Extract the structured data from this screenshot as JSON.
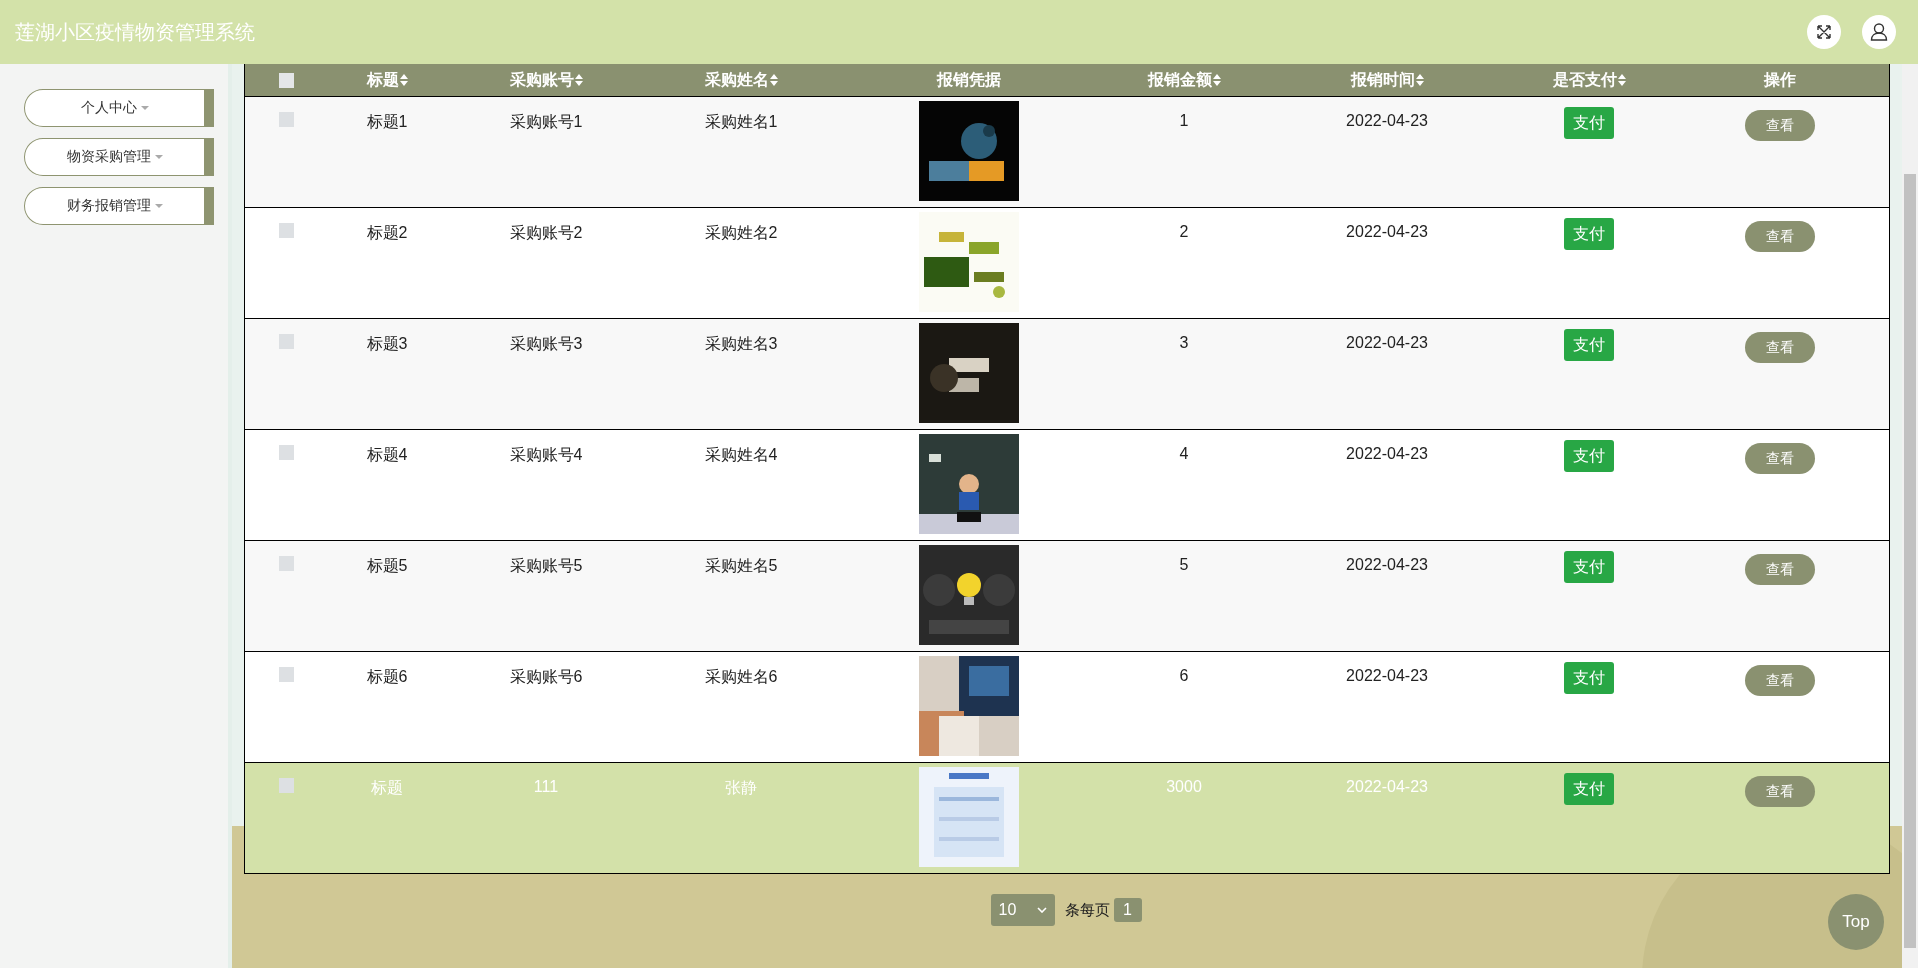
{
  "header": {
    "title": "莲湖小区疫情物资管理系统"
  },
  "sidebar": {
    "items": [
      {
        "label": "个人中心"
      },
      {
        "label": "物资采购管理"
      },
      {
        "label": "财务报销管理"
      }
    ]
  },
  "table": {
    "select_all": {
      "checked": false
    },
    "columns": [
      {
        "label": "标题",
        "sortable": true
      },
      {
        "label": "采购账号",
        "sortable": true
      },
      {
        "label": "采购姓名",
        "sortable": true
      },
      {
        "label": "报销凭据",
        "sortable": false
      },
      {
        "label": "报销金额",
        "sortable": true
      },
      {
        "label": "报销时间",
        "sortable": true
      },
      {
        "label": "是否支付",
        "sortable": true
      },
      {
        "label": "操作",
        "sortable": false
      }
    ],
    "rows": [
      {
        "title": "标题1",
        "account": "采购账号1",
        "name": "采购姓名1",
        "amount": "1",
        "time": "2022-04-23",
        "pay_button": "支付",
        "view_button": "查看",
        "checked": false,
        "highlighted": false
      },
      {
        "title": "标题2",
        "account": "采购账号2",
        "name": "采购姓名2",
        "amount": "2",
        "time": "2022-04-23",
        "pay_button": "支付",
        "view_button": "查看",
        "checked": false,
        "highlighted": false
      },
      {
        "title": "标题3",
        "account": "采购账号3",
        "name": "采购姓名3",
        "amount": "3",
        "time": "2022-04-23",
        "pay_button": "支付",
        "view_button": "查看",
        "checked": false,
        "highlighted": false
      },
      {
        "title": "标题4",
        "account": "采购账号4",
        "name": "采购姓名4",
        "amount": "4",
        "time": "2022-04-23",
        "pay_button": "支付",
        "view_button": "查看",
        "checked": false,
        "highlighted": false
      },
      {
        "title": "标题5",
        "account": "采购账号5",
        "name": "采购姓名5",
        "amount": "5",
        "time": "2022-04-23",
        "pay_button": "支付",
        "view_button": "查看",
        "checked": false,
        "highlighted": false
      },
      {
        "title": "标题6",
        "account": "采购账号6",
        "name": "采购姓名6",
        "amount": "6",
        "time": "2022-04-23",
        "pay_button": "支付",
        "view_button": "查看",
        "checked": false,
        "highlighted": false
      },
      {
        "title": "标题",
        "account": "111",
        "name": "张静",
        "amount": "3000",
        "time": "2022-04-23",
        "pay_button": "支付",
        "view_button": "查看",
        "checked": false,
        "highlighted": true
      }
    ]
  },
  "pagination": {
    "page_size": "10",
    "per_page_label": "条每页",
    "pages": [
      {
        "label": "1",
        "selected": true
      }
    ]
  },
  "top_button": "Top"
}
